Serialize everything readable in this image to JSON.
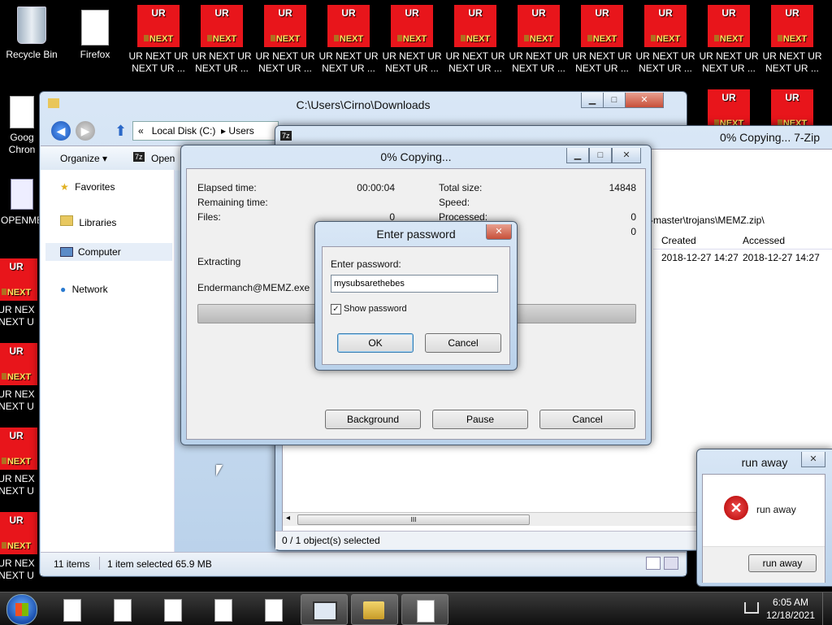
{
  "desktop": {
    "recycle_bin": "Recycle Bin",
    "firefox": "Firefox",
    "chrome": "Goog\nChron",
    "openme": "OPENME",
    "tile_top": "UR",
    "tile_bottom": "NEXT",
    "tile_label": "UR NEXT UR NEXT UR ...",
    "left_tile_label": "UR NEX NEXT U"
  },
  "explorer": {
    "title": "C:\\Users\\Cirno\\Downloads",
    "breadcrumb": [
      "«",
      "Local Disk (C:)",
      "Users"
    ],
    "toolbar": {
      "organize": "Organize ▾",
      "open": "Open"
    },
    "nav": [
      "Favorites",
      "Libraries",
      "Computer",
      "Network"
    ],
    "status": {
      "items": "11 items",
      "selected": "1 item selected  65.9 MB"
    }
  },
  "zip_window": {
    "title": "0% Copying... 7-Zip",
    "path": "-master\\trojans\\MEMZ.zip\\",
    "columns": [
      "Created",
      "Accessed"
    ],
    "row": [
      "2018-12-27 14:27",
      "2018-12-27 14:27"
    ],
    "status": "0 / 1 object(s) selected",
    "scroll_grip": "III"
  },
  "progress": {
    "title": "0% Copying...",
    "left": [
      {
        "label": "Elapsed time:",
        "value": "00:00:04"
      },
      {
        "label": "Remaining time:",
        "value": ""
      },
      {
        "label": "Files:",
        "value": "0"
      }
    ],
    "right": [
      {
        "label": "Total size:",
        "value": "14848"
      },
      {
        "label": "Speed:",
        "value": ""
      },
      {
        "label": "Processed:",
        "value": "0"
      },
      {
        "label": "",
        "value": "0"
      }
    ],
    "extracting": "Extracting",
    "filename": "Endermanch@MEMZ.exe",
    "progress_fraction": 0,
    "buttons": {
      "background": "Background",
      "pause": "Pause",
      "cancel": "Cancel"
    }
  },
  "password": {
    "title": "Enter password",
    "field_label": "Enter password:",
    "value": "mysubsarethebes",
    "show_password": "Show password",
    "ok": "OK",
    "cancel": "Cancel"
  },
  "runaway": {
    "title": "run away",
    "message": "run away",
    "button": "run away"
  },
  "tray": {
    "time": "6:05 AM",
    "date": "12/18/2021"
  }
}
